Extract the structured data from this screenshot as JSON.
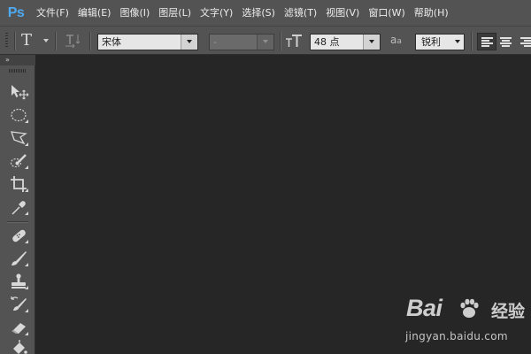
{
  "app": {
    "logo": "Ps",
    "theme_bg": "#262626",
    "chrome_bg": "#535353",
    "logo_color": "#4fa9f1"
  },
  "menu": {
    "items": [
      {
        "label": "文件(F)"
      },
      {
        "label": "编辑(E)"
      },
      {
        "label": "图像(I)"
      },
      {
        "label": "图层(L)"
      },
      {
        "label": "文字(Y)"
      },
      {
        "label": "选择(S)"
      },
      {
        "label": "滤镜(T)"
      },
      {
        "label": "视图(V)"
      },
      {
        "label": "窗口(W)"
      },
      {
        "label": "帮助(H)"
      }
    ]
  },
  "options": {
    "tool_glyph": "T",
    "font_family": "宋体",
    "font_style": "-",
    "font_size": "48 点",
    "antialias_glyph": "a",
    "antialias_glyph_sub": "a",
    "antialias": "锐利",
    "align_active": "left"
  },
  "toolbox": {
    "collapse_glyph": "»",
    "tools": [
      {
        "icon": "move-icon"
      },
      {
        "icon": "elliptical-marquee-icon"
      },
      {
        "icon": "polygonal-lasso-icon"
      },
      {
        "icon": "quick-selection-icon"
      },
      {
        "icon": "crop-icon"
      },
      {
        "icon": "eyedropper-icon"
      },
      {
        "icon": "spot-healing-icon"
      },
      {
        "icon": "brush-icon"
      },
      {
        "icon": "clone-stamp-icon"
      },
      {
        "icon": "history-brush-icon"
      },
      {
        "icon": "eraser-icon"
      },
      {
        "icon": "paint-bucket-icon"
      }
    ]
  },
  "watermark": {
    "brand_left": "Bai",
    "brand_right": "du",
    "product": "经验",
    "url": "jingyan.baidu.com"
  }
}
